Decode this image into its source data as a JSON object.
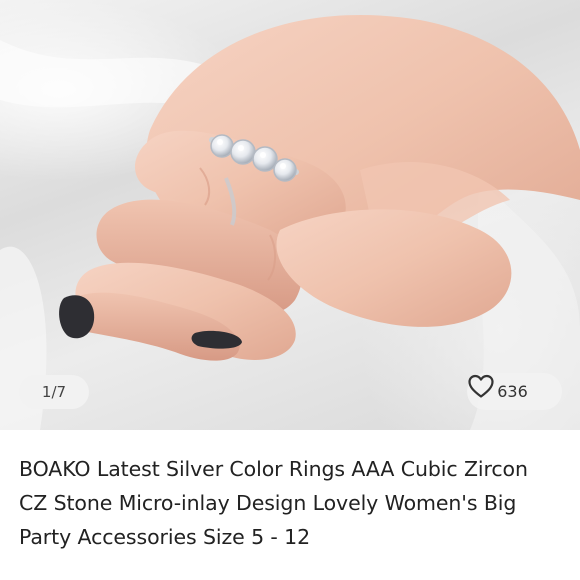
{
  "gallery": {
    "counter": "1/7",
    "likes_count": "636"
  },
  "listing": {
    "title": "BOAKO Latest Silver Color Rings AAA Cubic Zircon CZ Stone Micro-inlay Design Lovely Women's Big Party Accessories Size 5 - 12"
  },
  "icons": {
    "like": "heart-icon"
  },
  "colors": {
    "background": "#ffffff",
    "text": "#222222",
    "pill": "#f2f2f2"
  }
}
